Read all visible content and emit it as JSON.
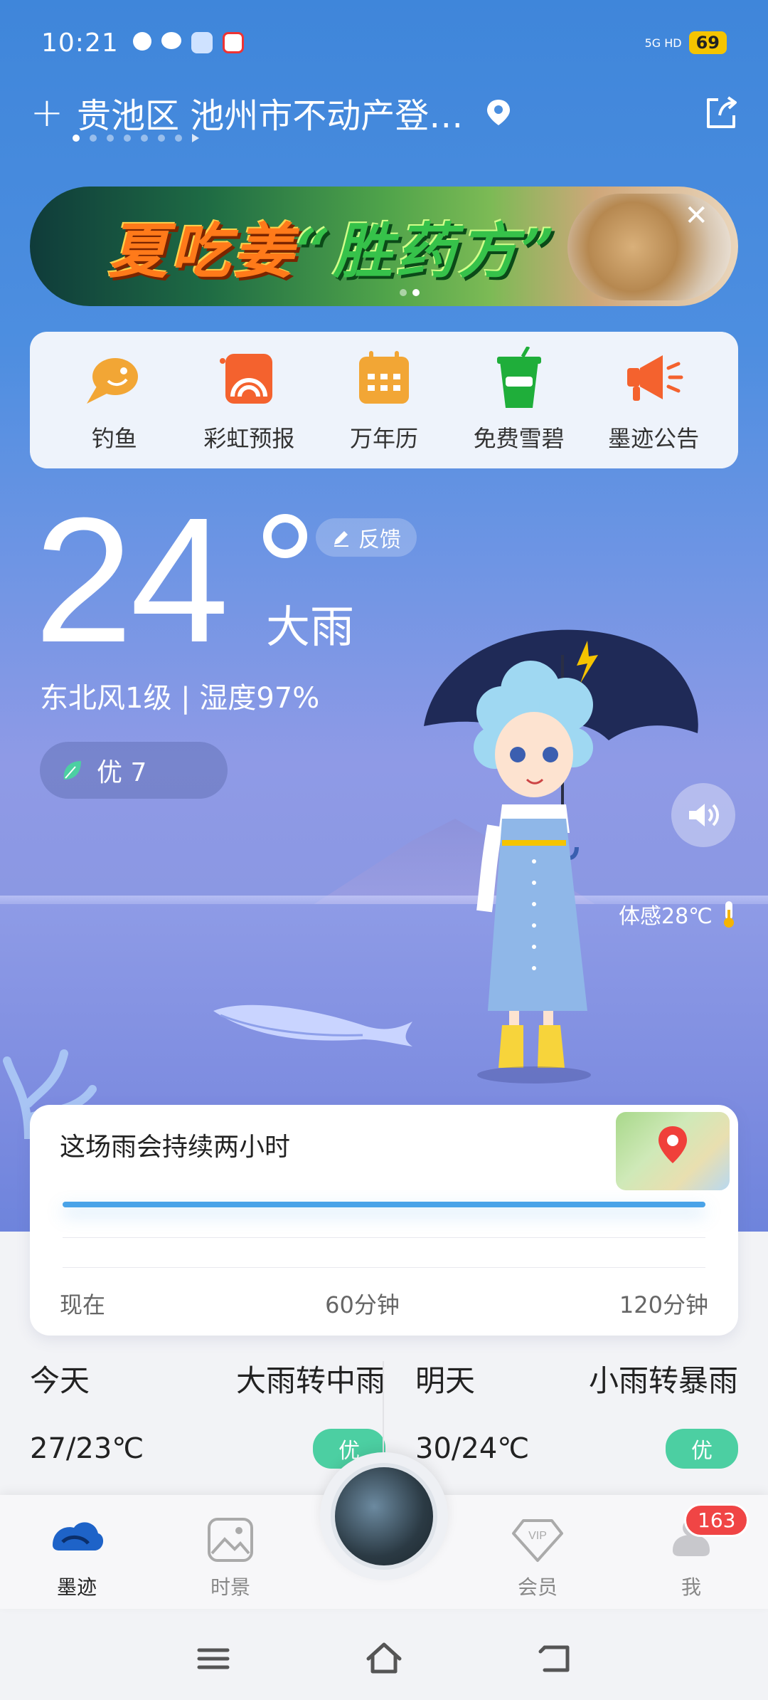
{
  "status_bar": {
    "time": "10:21",
    "network": "5G HD",
    "battery": "69"
  },
  "location": {
    "add_label": "+",
    "name": "贵池区 池州市不动产登…"
  },
  "banner": {
    "text_part1": "夏吃姜",
    "text_part2": "“胜药方”",
    "close_label": "✕"
  },
  "tools": [
    {
      "label": "钓鱼",
      "icon": "fish-icon"
    },
    {
      "label": "彩虹预报",
      "icon": "rainbow-icon"
    },
    {
      "label": "万年历",
      "icon": "calendar-icon"
    },
    {
      "label": "免费雪碧",
      "icon": "drink-cup-icon"
    },
    {
      "label": "墨迹公告",
      "icon": "megaphone-icon"
    }
  ],
  "weather": {
    "temperature": "24",
    "condition": "大雨",
    "feedback_label": "反馈",
    "wind_humidity": "东北风1级 | 湿度97%",
    "aqi": "优 7",
    "feels_like": "体感28℃"
  },
  "rain_card": {
    "title": "这场雨会持续两小时",
    "axis": [
      "现在",
      "60分钟",
      "120分钟"
    ]
  },
  "forecast": [
    {
      "day": "今天",
      "condition": "大雨转中雨",
      "temps": "27/23℃",
      "aqi": "优"
    },
    {
      "day": "明天",
      "condition": "小雨转暴雨",
      "temps": "30/24℃",
      "aqi": "优"
    }
  ],
  "tabs": [
    {
      "label": "墨迹",
      "icon": "moji-logo-icon"
    },
    {
      "label": "时景",
      "icon": "photo-icon"
    },
    {
      "label": "会员",
      "icon": "vip-icon"
    },
    {
      "label": "我",
      "icon": "profile-icon"
    }
  ],
  "me_badge": "163",
  "colors": {
    "accent_blue": "#4a8fe0",
    "aqi_green": "#4ccfa2",
    "badge_red": "#f04545"
  }
}
